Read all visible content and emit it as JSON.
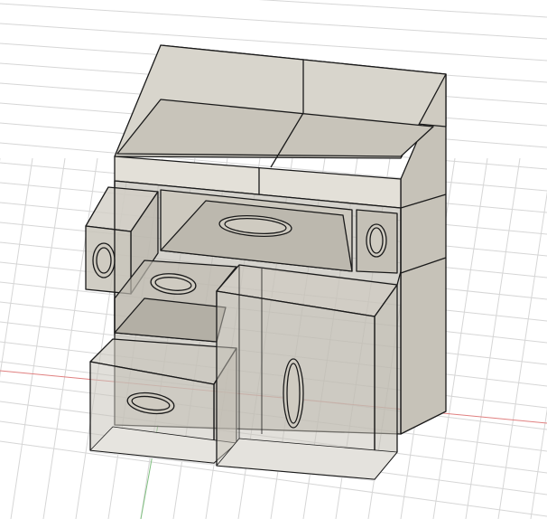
{
  "viewport": {
    "model": "cabinet-with-drawers",
    "colors": {
      "background": "#ffffff",
      "grid": "#d4d4d4",
      "x_axis": "#e07070",
      "y_axis": "#70c070",
      "body_fill": "#c9c4b8",
      "body_light": "#dedbd2",
      "glass_fill": "#bdb9b0",
      "edge": "#1a1a1a"
    }
  }
}
